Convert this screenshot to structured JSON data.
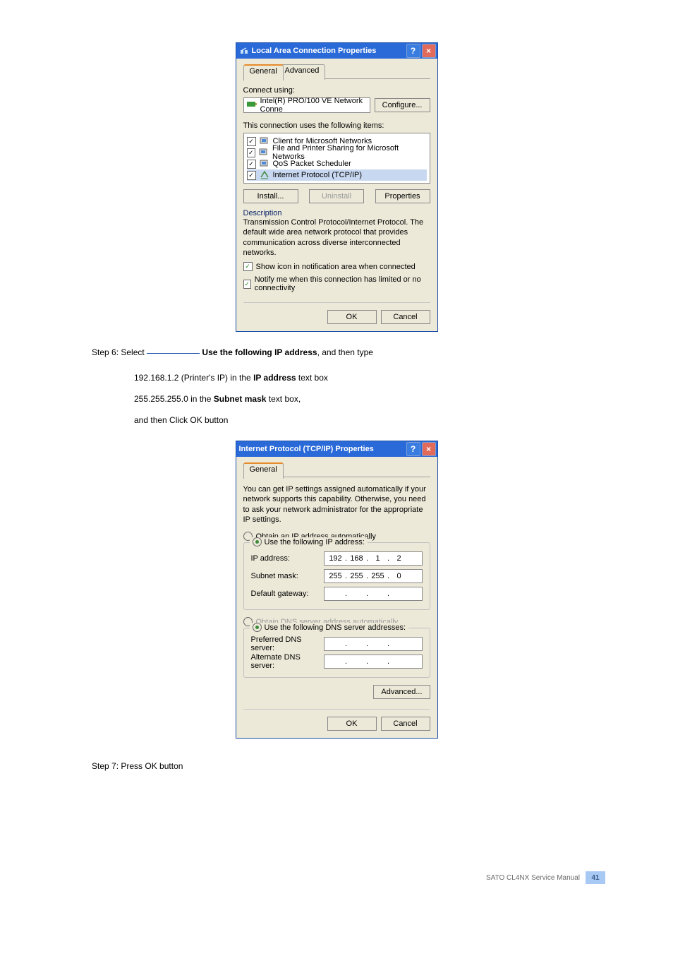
{
  "dialog1": {
    "title": "Local Area Connection Properties",
    "tab_general": "General",
    "tab_advanced": "Advanced",
    "connect_using": "Connect using:",
    "adapter": "Intel(R) PRO/100 VE Network Conne",
    "configure_btn": "Configure...",
    "uses_label": "This connection uses the following items:",
    "items": [
      "Client for Microsoft Networks",
      "File and Printer Sharing for Microsoft Networks",
      "QoS Packet Scheduler",
      "Internet Protocol (TCP/IP)"
    ],
    "install_btn": "Install...",
    "uninstall_btn": "Uninstall",
    "properties_btn": "Properties",
    "desc_head": "Description",
    "desc_text": "Transmission Control Protocol/Internet Protocol. The default wide area network protocol that provides communication across diverse interconnected networks.",
    "opt1": "Show icon in notification area when connected",
    "opt2": "Notify me when this connection has limited or no connectivity",
    "ok": "OK",
    "cancel": "Cancel"
  },
  "step6": {
    "label": "Step 6:",
    "text_before": "Select ",
    "text_bold": "Use the following IP address",
    "text_after": ", and then type",
    "line2": "192.168.1.2 (Printer's IP) in the ",
    "line2_bold": "IP address",
    "line2_after": " text box",
    "line3": "255.255.255.0 in the ",
    "line3_bold": "Subnet mask",
    "line3_after": " text box,",
    "line4": "and then Click OK button"
  },
  "dialog2": {
    "title": "Internet Protocol (TCP/IP) Properties",
    "tab_general": "General",
    "info": "You can get IP settings assigned automatically if your network supports this capability. Otherwise, you need to ask your network administrator for the appropriate IP settings.",
    "radio_auto_ip": "Obtain an IP address automatically",
    "radio_use_ip": "Use the following IP address:",
    "ip_label": "IP address:",
    "ip_value": [
      "192",
      "168",
      "1",
      "2"
    ],
    "subnet_label": "Subnet mask:",
    "subnet_value": [
      "255",
      "255",
      "255",
      "0"
    ],
    "gateway_label": "Default gateway:",
    "radio_auto_dns": "Obtain DNS server address automatically",
    "radio_use_dns": "Use the following DNS server addresses:",
    "pref_dns": "Preferred DNS server:",
    "alt_dns": "Alternate DNS server:",
    "advanced_btn": "Advanced...",
    "ok": "OK",
    "cancel": "Cancel"
  },
  "step7": {
    "label": "Step 7:",
    "text": "Press OK button"
  },
  "footer": {
    "product": "SATO CL4NX",
    "manual": "Service Manual",
    "page": "41"
  }
}
